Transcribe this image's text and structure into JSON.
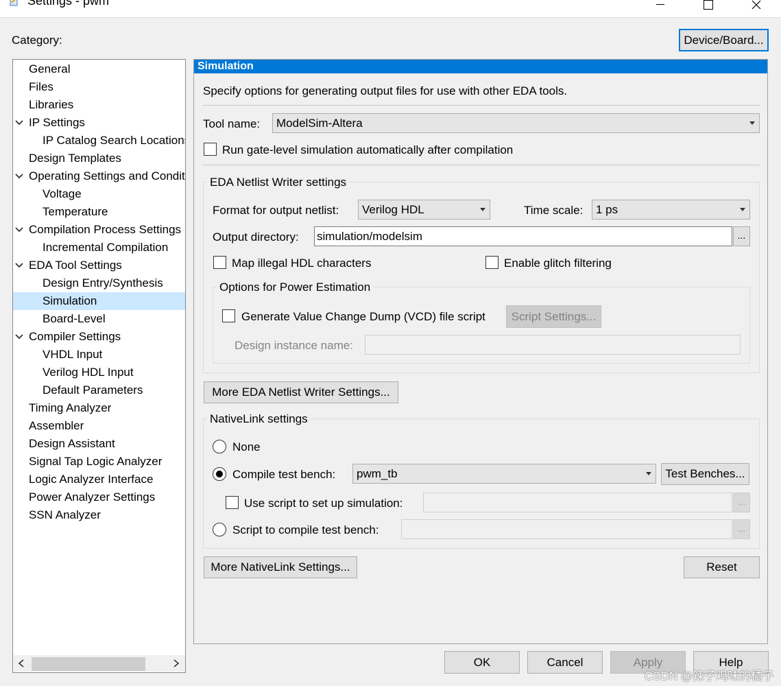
{
  "window": {
    "title": "Settings - pwm"
  },
  "category_label": "Category:",
  "device_board_button": "Device/Board...",
  "tree": [
    {
      "label": "General",
      "level": 0,
      "expandable": false
    },
    {
      "label": "Files",
      "level": 0,
      "expandable": false
    },
    {
      "label": "Libraries",
      "level": 0,
      "expandable": false
    },
    {
      "label": "IP Settings",
      "level": 0,
      "expandable": true
    },
    {
      "label": "IP Catalog Search Locations",
      "level": 1,
      "expandable": false
    },
    {
      "label": "Design Templates",
      "level": 0,
      "expandable": false
    },
    {
      "label": "Operating Settings and Conditions",
      "level": 0,
      "expandable": true
    },
    {
      "label": "Voltage",
      "level": 1,
      "expandable": false
    },
    {
      "label": "Temperature",
      "level": 1,
      "expandable": false
    },
    {
      "label": "Compilation Process Settings",
      "level": 0,
      "expandable": true
    },
    {
      "label": "Incremental Compilation",
      "level": 1,
      "expandable": false
    },
    {
      "label": "EDA Tool Settings",
      "level": 0,
      "expandable": true
    },
    {
      "label": "Design Entry/Synthesis",
      "level": 1,
      "expandable": false
    },
    {
      "label": "Simulation",
      "level": 1,
      "expandable": false,
      "selected": true
    },
    {
      "label": "Board-Level",
      "level": 1,
      "expandable": false
    },
    {
      "label": "Compiler Settings",
      "level": 0,
      "expandable": true
    },
    {
      "label": "VHDL Input",
      "level": 1,
      "expandable": false
    },
    {
      "label": "Verilog HDL Input",
      "level": 1,
      "expandable": false
    },
    {
      "label": "Default Parameters",
      "level": 1,
      "expandable": false
    },
    {
      "label": "Timing Analyzer",
      "level": 0,
      "expandable": false
    },
    {
      "label": "Assembler",
      "level": 0,
      "expandable": false
    },
    {
      "label": "Design Assistant",
      "level": 0,
      "expandable": false
    },
    {
      "label": "Signal Tap Logic Analyzer",
      "level": 0,
      "expandable": false
    },
    {
      "label": "Logic Analyzer Interface",
      "level": 0,
      "expandable": false
    },
    {
      "label": "Power Analyzer Settings",
      "level": 0,
      "expandable": false
    },
    {
      "label": "SSN Analyzer",
      "level": 0,
      "expandable": false
    }
  ],
  "panel": {
    "header": "Simulation",
    "description": "Specify options for generating output files for use with other EDA tools.",
    "tool_name_label": "Tool name:",
    "tool_name_value": "ModelSim-Altera",
    "run_gate_level_label": "Run gate-level simulation automatically after compilation",
    "netlist_group_label": "EDA Netlist Writer settings",
    "format_label": "Format for output netlist:",
    "format_value": "Verilog HDL",
    "time_scale_label": "Time scale:",
    "time_scale_value": "1 ps",
    "output_dir_label": "Output directory:",
    "output_dir_value": "simulation/modelsim",
    "browse_label": "...",
    "map_illegal_label": "Map illegal HDL characters",
    "glitch_label": "Enable glitch filtering",
    "power_group_label": "Options for Power Estimation",
    "vcd_label": "Generate Value Change Dump (VCD) file script",
    "script_settings_button": "Script Settings...",
    "design_instance_label": "Design instance name:",
    "more_netlist_button": "More EDA Netlist Writer Settings...",
    "nativelink_group_label": "NativeLink settings",
    "none_label": "None",
    "compile_tb_label": "Compile test bench:",
    "compile_tb_value": "pwm_tb",
    "test_benches_button": "Test Benches...",
    "use_script_label": "Use script to set up simulation:",
    "script_compile_label": "Script to compile test bench:",
    "more_nativelink_button": "More NativeLink Settings...",
    "reset_button": "Reset"
  },
  "footer": {
    "ok": "OK",
    "cancel": "Cancel",
    "apply": "Apply",
    "help": "Help"
  },
  "watermark": "CSDN @辣子鸡味的橘子"
}
